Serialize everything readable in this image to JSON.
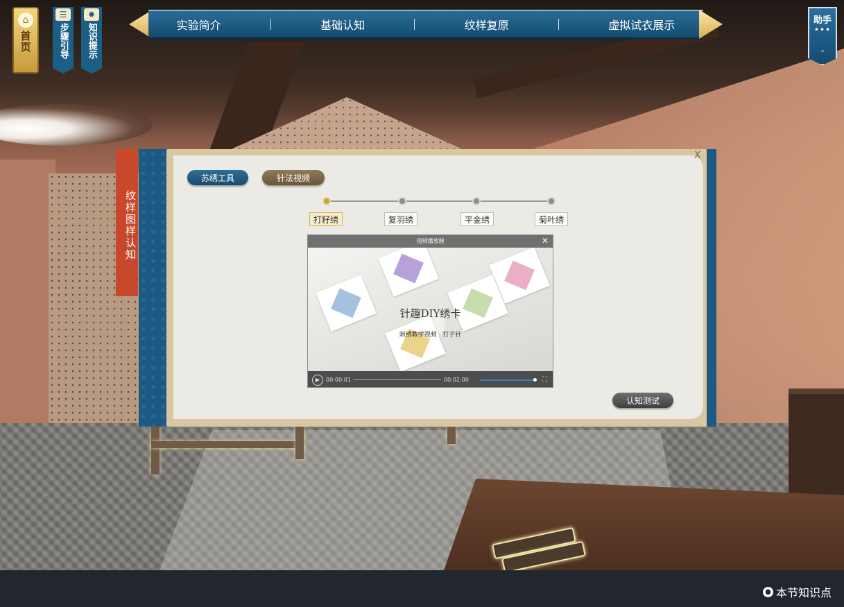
{
  "left_buttons": {
    "home": {
      "label": "首页",
      "icon": "home-icon"
    },
    "steps": {
      "label": "步骤引导",
      "icon": "list-icon"
    },
    "tips": {
      "label": "知识提示",
      "icon": "lightbulb-icon"
    }
  },
  "nav": {
    "items": [
      "实验简介",
      "基础认知",
      "纹样复原",
      "虚拟试衣展示"
    ]
  },
  "helper": {
    "label": "助手",
    "dots": "•••",
    "chevron": "⌄"
  },
  "side_tab": {
    "label": "纹样图样认知"
  },
  "panel": {
    "close_label": "X",
    "tabs": [
      "苏绣工具",
      "针法视频"
    ],
    "steps": [
      "打籽绣",
      "复羽绣",
      "平金绣",
      "菊叶绣"
    ],
    "active_step": 0,
    "test_button": "认知测试"
  },
  "player": {
    "title": "视频播放器",
    "close": "✕",
    "video_title": "针趣DIY绣卡",
    "video_subtitle": "刺绣教学视频 · 打子针",
    "current_time": "00:00:01",
    "duration": "00:02:00"
  },
  "footer": {
    "knowledge_label": "本节知识点"
  },
  "colors": {
    "nav_blue": "#1d5a83",
    "accent_gold": "#d6ae55",
    "side_tab_red": "#c9472b",
    "footer_bg": "#22272f"
  }
}
